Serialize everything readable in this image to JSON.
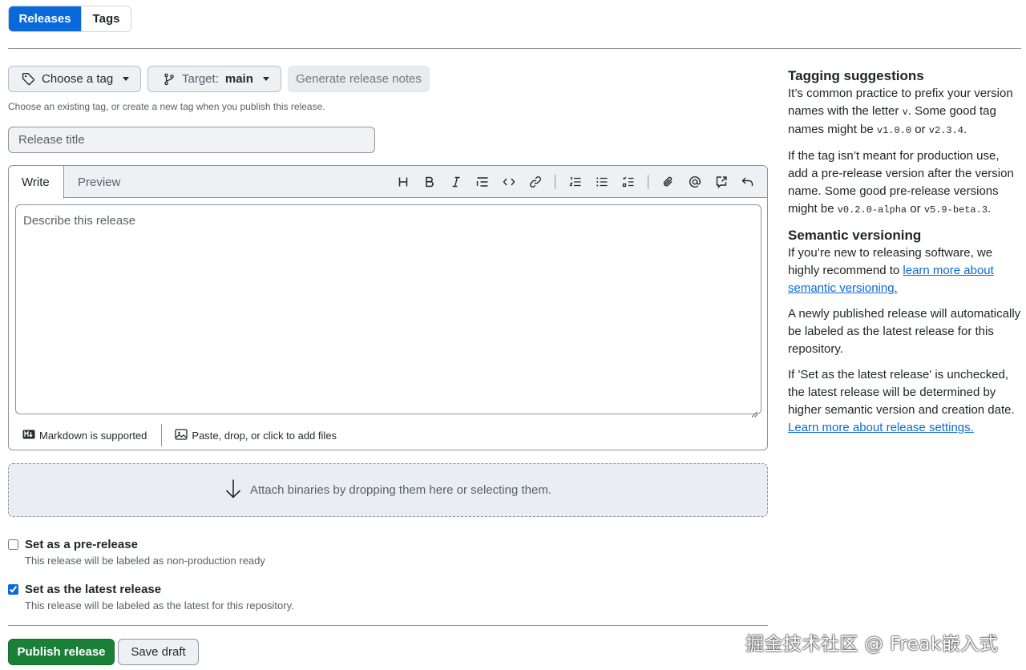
{
  "top_tabs": {
    "releases": "Releases",
    "tags": "Tags"
  },
  "tag_picker": {
    "label": "Choose a tag",
    "icon": "tag-icon"
  },
  "target_picker": {
    "prefix": "Target:",
    "value": "main",
    "icon": "git-branch-icon"
  },
  "generate_notes_label": "Generate release notes",
  "tag_hint": "Choose an existing tag, or create a new tag when you publish this release.",
  "release_title": {
    "value": "",
    "placeholder": "Release title"
  },
  "editor": {
    "write_tab": "Write",
    "preview_tab": "Preview",
    "placeholder": "Describe this release",
    "toolbar_icons": [
      "heading-icon",
      "bold-icon",
      "italic-icon",
      "quote-icon",
      "code-icon",
      "link-icon",
      "numbered-list-icon",
      "unordered-list-icon",
      "task-list-icon",
      "attach-icon",
      "mention-icon",
      "reference-icon",
      "undo-icon"
    ],
    "markdown_note": "Markdown is supported",
    "files_note": "Paste, drop, or click to add files"
  },
  "dropzone_text": "Attach binaries by dropping them here or selecting them.",
  "prerelease": {
    "checked": false,
    "title": "Set as a pre-release",
    "desc": "This release will be labeled as non-production ready"
  },
  "latest": {
    "checked": true,
    "title": "Set as the latest release",
    "desc": "This release will be labeled as the latest for this repository."
  },
  "actions": {
    "publish": "Publish release",
    "draft": "Save draft"
  },
  "sidebar": {
    "tagging_title": "Tagging suggestions",
    "tagging_p1_a": "It’s common practice to prefix your version names with the letter ",
    "tagging_p1_code_v": "v",
    "tagging_p1_b": ". Some good tag names might be ",
    "tagging_p1_code1": "v1.0.0",
    "tagging_p1_c": " or ",
    "tagging_p1_code2": "v2.3.4",
    "tagging_p1_d": ".",
    "tagging_p2_a": "If the tag isn’t meant for production use, add a pre-release version after the version name. Some good pre-release versions might be ",
    "tagging_p2_code1": "v0.2.0-alpha",
    "tagging_p2_b": " or ",
    "tagging_p2_code2": "v5.9-beta.3",
    "tagging_p2_c": ".",
    "semver_title": "Semantic versioning",
    "semver_p1_a": "If you’re new to releasing software, we highly recommend to ",
    "semver_p1_link": "learn more about semantic versioning.",
    "semver_p2": "A newly published release will automatically be labeled as the latest release for this repository.",
    "semver_p3_a": "If 'Set as the latest release' is unchecked, the latest release will be determined by higher semantic version and creation date. ",
    "semver_p3_link": "Learn more about release settings."
  },
  "watermark": "掘金技术社区 @ Freak嵌入式",
  "colors": {
    "accent": "#0969da",
    "publish": "#1a7f37"
  }
}
